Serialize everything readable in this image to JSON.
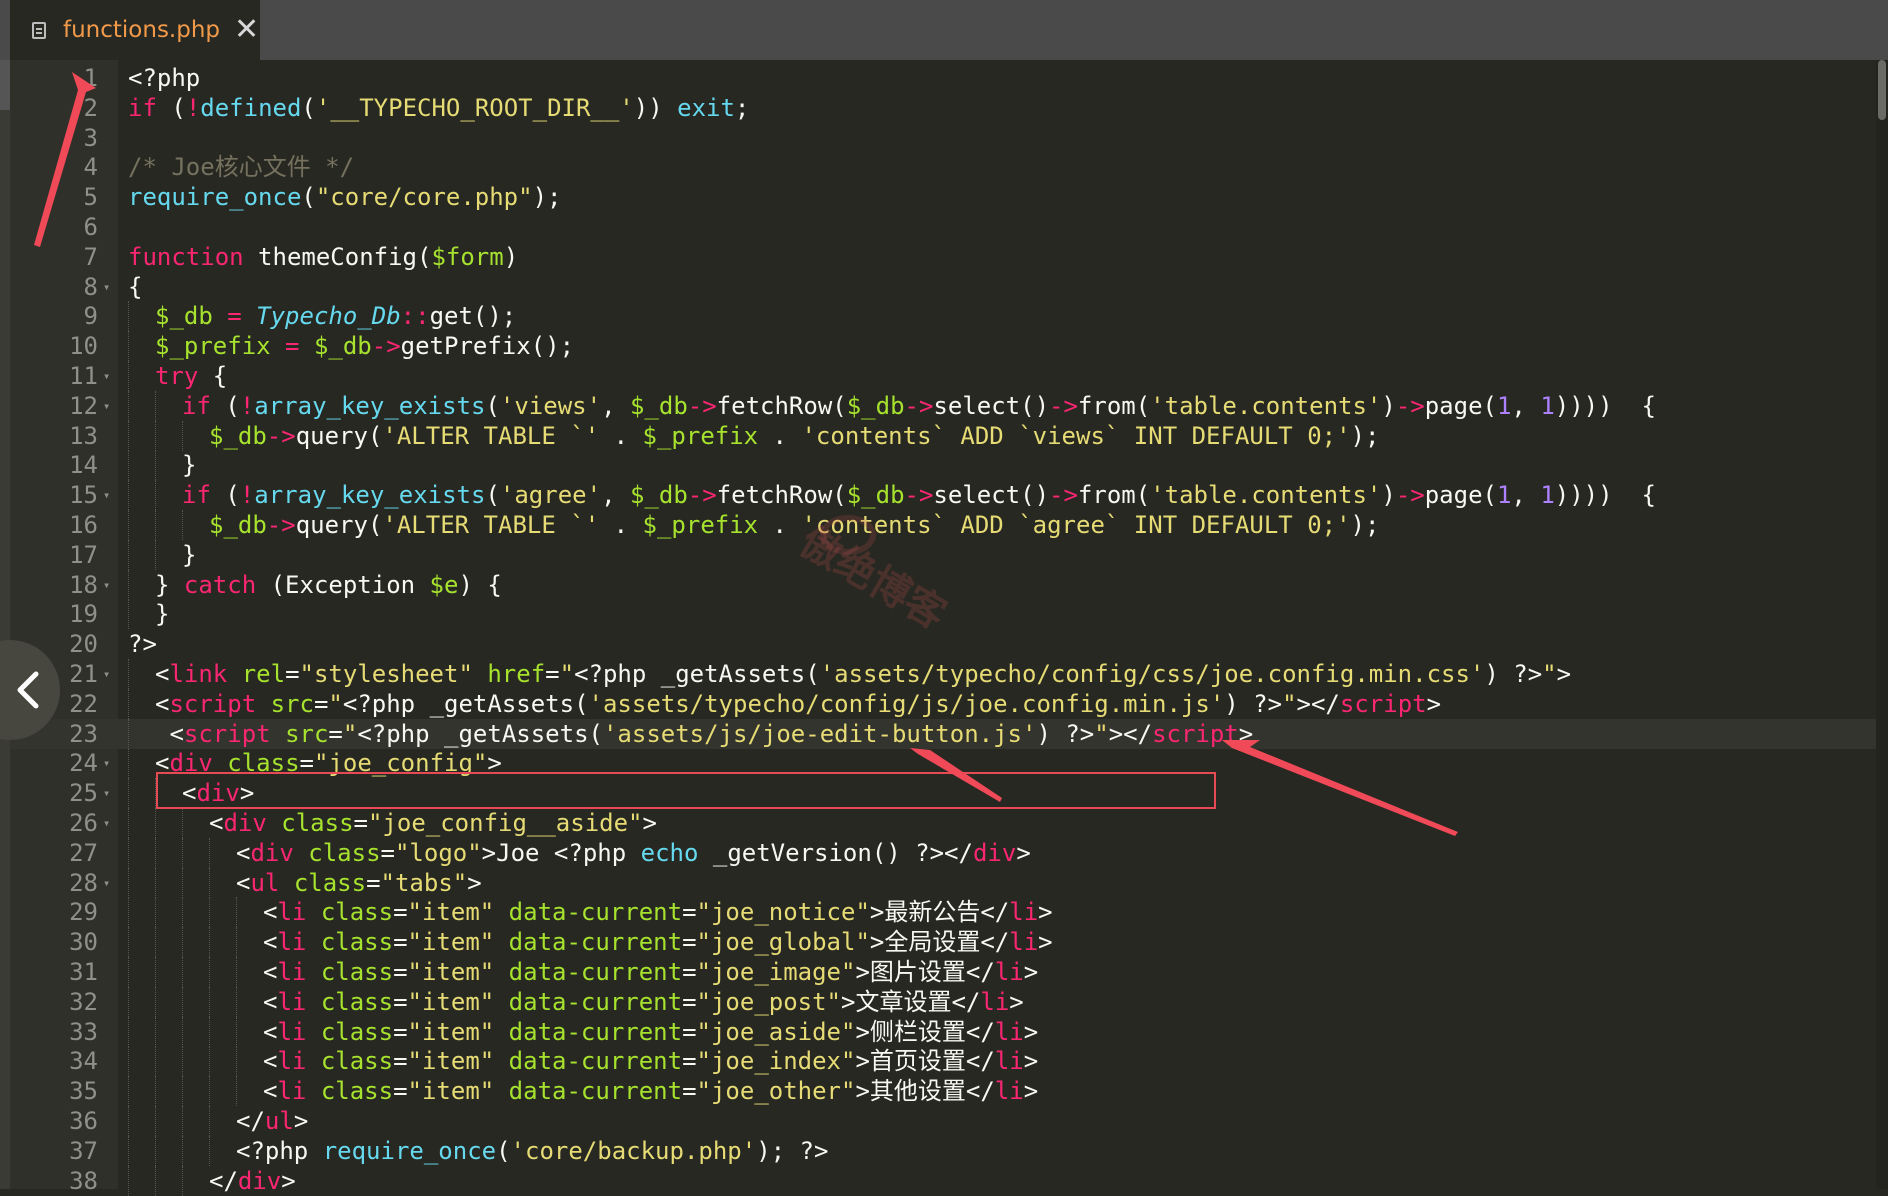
{
  "tab": {
    "title": "functions.php",
    "icon": "file-icon",
    "close_label": "✕"
  },
  "colors": {
    "keyword": "#f92672",
    "string": "#e6db74",
    "comment": "#75715e",
    "function": "#66d9ef",
    "variable": "#a6e22e",
    "number": "#ae81ff",
    "annotation": "#e74a54",
    "background": "#272822"
  },
  "watermark": "傲绝博客",
  "lines": [
    {
      "n": "1",
      "f": false,
      "indent": 0,
      "toks": [
        [
          "w",
          "<?php"
        ]
      ]
    },
    {
      "n": "2",
      "f": false,
      "indent": 0,
      "toks": [
        [
          "k",
          "if"
        ],
        [
          "w",
          " ("
        ],
        [
          "k",
          "!"
        ],
        [
          "f",
          "defined"
        ],
        [
          "w",
          "("
        ],
        [
          "s",
          "'__TYPECHO_ROOT_DIR__'"
        ],
        [
          "w",
          ")) "
        ],
        [
          "f",
          "exit"
        ],
        [
          "w",
          ";"
        ]
      ]
    },
    {
      "n": "3",
      "f": false,
      "indent": 0,
      "toks": []
    },
    {
      "n": "4",
      "f": false,
      "indent": 0,
      "toks": [
        [
          "c",
          "/* Joe核心文件 */"
        ]
      ]
    },
    {
      "n": "5",
      "f": false,
      "indent": 0,
      "toks": [
        [
          "f",
          "require_once"
        ],
        [
          "w",
          "("
        ],
        [
          "s",
          "\"core/core.php\""
        ],
        [
          "w",
          ");"
        ]
      ]
    },
    {
      "n": "6",
      "f": false,
      "indent": 0,
      "toks": []
    },
    {
      "n": "7",
      "f": false,
      "indent": 0,
      "toks": [
        [
          "k",
          "function"
        ],
        [
          "w",
          " themeConfig("
        ],
        [
          "v",
          "$form"
        ],
        [
          "w",
          ")"
        ]
      ]
    },
    {
      "n": "8",
      "f": true,
      "indent": 0,
      "toks": [
        [
          "w",
          "{"
        ]
      ]
    },
    {
      "n": "9",
      "f": false,
      "indent": 1,
      "toks": [
        [
          "v",
          "$_db"
        ],
        [
          "w",
          " "
        ],
        [
          "k",
          "="
        ],
        [
          "w",
          " "
        ],
        [
          "i",
          "Typecho_Db"
        ],
        [
          "k",
          "::"
        ],
        [
          "w",
          "get();"
        ]
      ]
    },
    {
      "n": "10",
      "f": false,
      "indent": 1,
      "toks": [
        [
          "v",
          "$_prefix"
        ],
        [
          "w",
          " "
        ],
        [
          "k",
          "="
        ],
        [
          "w",
          " "
        ],
        [
          "v",
          "$_db"
        ],
        [
          "k",
          "->"
        ],
        [
          "w",
          "getPrefix();"
        ]
      ]
    },
    {
      "n": "11",
      "f": true,
      "indent": 1,
      "toks": [
        [
          "k",
          "try"
        ],
        [
          "w",
          " {"
        ]
      ]
    },
    {
      "n": "12",
      "f": true,
      "indent": 2,
      "toks": [
        [
          "k",
          "if"
        ],
        [
          "w",
          " ("
        ],
        [
          "k",
          "!"
        ],
        [
          "f",
          "array_key_exists"
        ],
        [
          "w",
          "("
        ],
        [
          "s",
          "'views'"
        ],
        [
          "w",
          ", "
        ],
        [
          "v",
          "$_db"
        ],
        [
          "k",
          "->"
        ],
        [
          "w",
          "fetchRow("
        ],
        [
          "v",
          "$_db"
        ],
        [
          "k",
          "->"
        ],
        [
          "w",
          "select()"
        ],
        [
          "k",
          "->"
        ],
        [
          "w",
          "from("
        ],
        [
          "s",
          "'table.contents'"
        ],
        [
          "w",
          ")"
        ],
        [
          "k",
          "->"
        ],
        [
          "w",
          "page("
        ],
        [
          "n",
          "1"
        ],
        [
          "w",
          ", "
        ],
        [
          "n",
          "1"
        ],
        [
          "w",
          "))))  {"
        ]
      ]
    },
    {
      "n": "13",
      "f": false,
      "indent": 3,
      "toks": [
        [
          "v",
          "$_db"
        ],
        [
          "k",
          "->"
        ],
        [
          "w",
          "query("
        ],
        [
          "s",
          "'ALTER TABLE `'"
        ],
        [
          "w",
          " . "
        ],
        [
          "v",
          "$_prefix"
        ],
        [
          "w",
          " . "
        ],
        [
          "s",
          "'contents` ADD `views` INT DEFAULT 0;'"
        ],
        [
          "w",
          ");"
        ]
      ]
    },
    {
      "n": "14",
      "f": false,
      "indent": 2,
      "toks": [
        [
          "w",
          "}"
        ]
      ]
    },
    {
      "n": "15",
      "f": true,
      "indent": 2,
      "toks": [
        [
          "k",
          "if"
        ],
        [
          "w",
          " ("
        ],
        [
          "k",
          "!"
        ],
        [
          "f",
          "array_key_exists"
        ],
        [
          "w",
          "("
        ],
        [
          "s",
          "'agree'"
        ],
        [
          "w",
          ", "
        ],
        [
          "v",
          "$_db"
        ],
        [
          "k",
          "->"
        ],
        [
          "w",
          "fetchRow("
        ],
        [
          "v",
          "$_db"
        ],
        [
          "k",
          "->"
        ],
        [
          "w",
          "select()"
        ],
        [
          "k",
          "->"
        ],
        [
          "w",
          "from("
        ],
        [
          "s",
          "'table.contents'"
        ],
        [
          "w",
          ")"
        ],
        [
          "k",
          "->"
        ],
        [
          "w",
          "page("
        ],
        [
          "n",
          "1"
        ],
        [
          "w",
          ", "
        ],
        [
          "n",
          "1"
        ],
        [
          "w",
          "))))  {"
        ]
      ]
    },
    {
      "n": "16",
      "f": false,
      "indent": 3,
      "toks": [
        [
          "v",
          "$_db"
        ],
        [
          "k",
          "->"
        ],
        [
          "w",
          "query("
        ],
        [
          "s",
          "'ALTER TABLE `'"
        ],
        [
          "w",
          " . "
        ],
        [
          "v",
          "$_prefix"
        ],
        [
          "w",
          " . "
        ],
        [
          "s",
          "'contents` ADD `agree` INT DEFAULT 0;'"
        ],
        [
          "w",
          ");"
        ]
      ]
    },
    {
      "n": "17",
      "f": false,
      "indent": 2,
      "toks": [
        [
          "w",
          "}"
        ]
      ]
    },
    {
      "n": "18",
      "f": true,
      "indent": 1,
      "toks": [
        [
          "w",
          "} "
        ],
        [
          "k",
          "catch"
        ],
        [
          "w",
          " (Exception "
        ],
        [
          "v",
          "$e"
        ],
        [
          "w",
          ") {"
        ]
      ]
    },
    {
      "n": "19",
      "f": false,
      "indent": 1,
      "toks": [
        [
          "w",
          "}"
        ]
      ]
    },
    {
      "n": "20",
      "f": false,
      "indent": 0,
      "toks": [
        [
          "w",
          "?>"
        ]
      ]
    },
    {
      "n": "21",
      "f": true,
      "indent": 1,
      "toks": [
        [
          "w",
          "<"
        ],
        [
          "t",
          "link"
        ],
        [
          "w",
          " "
        ],
        [
          "a",
          "rel"
        ],
        [
          "w",
          "="
        ],
        [
          "s",
          "\"stylesheet\""
        ],
        [
          "w",
          " "
        ],
        [
          "a",
          "href"
        ],
        [
          "w",
          "="
        ],
        [
          "s",
          "\""
        ],
        [
          "w",
          "<?php _getAssets("
        ],
        [
          "s",
          "'assets/typecho/config/css/joe.config.min.css'"
        ],
        [
          "w",
          ") ?>"
        ],
        [
          "s",
          "\""
        ],
        [
          "w",
          ">"
        ]
      ]
    },
    {
      "n": "22",
      "f": false,
      "indent": 1,
      "toks": [
        [
          "w",
          "<"
        ],
        [
          "t",
          "script"
        ],
        [
          "w",
          " "
        ],
        [
          "a",
          "src"
        ],
        [
          "w",
          "="
        ],
        [
          "s",
          "\""
        ],
        [
          "w",
          "<?php _getAssets("
        ],
        [
          "s",
          "'assets/typecho/config/js/joe.config.min.js'"
        ],
        [
          "w",
          ") ?>"
        ],
        [
          "s",
          "\""
        ],
        [
          "w",
          "></"
        ],
        [
          "t",
          "script"
        ],
        [
          "w",
          ">"
        ]
      ]
    },
    {
      "n": "23",
      "f": false,
      "indent": 1,
      "active": true,
      "toks": [
        [
          "w",
          " <"
        ],
        [
          "t",
          "script"
        ],
        [
          "w",
          " "
        ],
        [
          "a",
          "src"
        ],
        [
          "w",
          "="
        ],
        [
          "s",
          "\""
        ],
        [
          "w",
          "<?php _getAssets("
        ],
        [
          "s",
          "'assets/js/joe-edit-button.js'"
        ],
        [
          "w",
          ") ?>"
        ],
        [
          "s",
          "\""
        ],
        [
          "w",
          "></"
        ],
        [
          "t",
          "script"
        ],
        [
          "w",
          ">"
        ]
      ]
    },
    {
      "n": "24",
      "f": true,
      "indent": 1,
      "toks": [
        [
          "w",
          "<"
        ],
        [
          "t",
          "div"
        ],
        [
          "w",
          " "
        ],
        [
          "a",
          "class"
        ],
        [
          "w",
          "="
        ],
        [
          "s",
          "\"joe_config\""
        ],
        [
          "w",
          ">"
        ]
      ]
    },
    {
      "n": "25",
      "f": true,
      "indent": 2,
      "toks": [
        [
          "w",
          "<"
        ],
        [
          "t",
          "div"
        ],
        [
          "w",
          ">"
        ]
      ]
    },
    {
      "n": "26",
      "f": true,
      "indent": 3,
      "toks": [
        [
          "w",
          "<"
        ],
        [
          "t",
          "div"
        ],
        [
          "w",
          " "
        ],
        [
          "a",
          "class"
        ],
        [
          "w",
          "="
        ],
        [
          "s",
          "\"joe_config__aside\""
        ],
        [
          "w",
          ">"
        ]
      ]
    },
    {
      "n": "27",
      "f": false,
      "indent": 4,
      "toks": [
        [
          "w",
          "<"
        ],
        [
          "t",
          "div"
        ],
        [
          "w",
          " "
        ],
        [
          "a",
          "class"
        ],
        [
          "w",
          "="
        ],
        [
          "s",
          "\"logo\""
        ],
        [
          "w",
          ">Joe <?php "
        ],
        [
          "f",
          "echo"
        ],
        [
          "w",
          " _getVersion() ?></"
        ],
        [
          "t",
          "div"
        ],
        [
          "w",
          ">"
        ]
      ]
    },
    {
      "n": "28",
      "f": true,
      "indent": 4,
      "toks": [
        [
          "w",
          "<"
        ],
        [
          "t",
          "ul"
        ],
        [
          "w",
          " "
        ],
        [
          "a",
          "class"
        ],
        [
          "w",
          "="
        ],
        [
          "s",
          "\"tabs\""
        ],
        [
          "w",
          ">"
        ]
      ]
    },
    {
      "n": "29",
      "f": false,
      "indent": 5,
      "toks": [
        [
          "w",
          "<"
        ],
        [
          "t",
          "li"
        ],
        [
          "w",
          " "
        ],
        [
          "a",
          "class"
        ],
        [
          "w",
          "="
        ],
        [
          "s",
          "\"item\""
        ],
        [
          "w",
          " "
        ],
        [
          "a",
          "data-current"
        ],
        [
          "w",
          "="
        ],
        [
          "s",
          "\"joe_notice\""
        ],
        [
          "w",
          ">最新公告</"
        ],
        [
          "t",
          "li"
        ],
        [
          "w",
          ">"
        ]
      ]
    },
    {
      "n": "30",
      "f": false,
      "indent": 5,
      "toks": [
        [
          "w",
          "<"
        ],
        [
          "t",
          "li"
        ],
        [
          "w",
          " "
        ],
        [
          "a",
          "class"
        ],
        [
          "w",
          "="
        ],
        [
          "s",
          "\"item\""
        ],
        [
          "w",
          " "
        ],
        [
          "a",
          "data-current"
        ],
        [
          "w",
          "="
        ],
        [
          "s",
          "\"joe_global\""
        ],
        [
          "w",
          ">全局设置</"
        ],
        [
          "t",
          "li"
        ],
        [
          "w",
          ">"
        ]
      ]
    },
    {
      "n": "31",
      "f": false,
      "indent": 5,
      "toks": [
        [
          "w",
          "<"
        ],
        [
          "t",
          "li"
        ],
        [
          "w",
          " "
        ],
        [
          "a",
          "class"
        ],
        [
          "w",
          "="
        ],
        [
          "s",
          "\"item\""
        ],
        [
          "w",
          " "
        ],
        [
          "a",
          "data-current"
        ],
        [
          "w",
          "="
        ],
        [
          "s",
          "\"joe_image\""
        ],
        [
          "w",
          ">图片设置</"
        ],
        [
          "t",
          "li"
        ],
        [
          "w",
          ">"
        ]
      ]
    },
    {
      "n": "32",
      "f": false,
      "indent": 5,
      "toks": [
        [
          "w",
          "<"
        ],
        [
          "t",
          "li"
        ],
        [
          "w",
          " "
        ],
        [
          "a",
          "class"
        ],
        [
          "w",
          "="
        ],
        [
          "s",
          "\"item\""
        ],
        [
          "w",
          " "
        ],
        [
          "a",
          "data-current"
        ],
        [
          "w",
          "="
        ],
        [
          "s",
          "\"joe_post\""
        ],
        [
          "w",
          ">文章设置</"
        ],
        [
          "t",
          "li"
        ],
        [
          "w",
          ">"
        ]
      ]
    },
    {
      "n": "33",
      "f": false,
      "indent": 5,
      "toks": [
        [
          "w",
          "<"
        ],
        [
          "t",
          "li"
        ],
        [
          "w",
          " "
        ],
        [
          "a",
          "class"
        ],
        [
          "w",
          "="
        ],
        [
          "s",
          "\"item\""
        ],
        [
          "w",
          " "
        ],
        [
          "a",
          "data-current"
        ],
        [
          "w",
          "="
        ],
        [
          "s",
          "\"joe_aside\""
        ],
        [
          "w",
          ">侧栏设置</"
        ],
        [
          "t",
          "li"
        ],
        [
          "w",
          ">"
        ]
      ]
    },
    {
      "n": "34",
      "f": false,
      "indent": 5,
      "toks": [
        [
          "w",
          "<"
        ],
        [
          "t",
          "li"
        ],
        [
          "w",
          " "
        ],
        [
          "a",
          "class"
        ],
        [
          "w",
          "="
        ],
        [
          "s",
          "\"item\""
        ],
        [
          "w",
          " "
        ],
        [
          "a",
          "data-current"
        ],
        [
          "w",
          "="
        ],
        [
          "s",
          "\"joe_index\""
        ],
        [
          "w",
          ">首页设置</"
        ],
        [
          "t",
          "li"
        ],
        [
          "w",
          ">"
        ]
      ]
    },
    {
      "n": "35",
      "f": false,
      "indent": 5,
      "toks": [
        [
          "w",
          "<"
        ],
        [
          "t",
          "li"
        ],
        [
          "w",
          " "
        ],
        [
          "a",
          "class"
        ],
        [
          "w",
          "="
        ],
        [
          "s",
          "\"item\""
        ],
        [
          "w",
          " "
        ],
        [
          "a",
          "data-current"
        ],
        [
          "w",
          "="
        ],
        [
          "s",
          "\"joe_other\""
        ],
        [
          "w",
          ">其他设置</"
        ],
        [
          "t",
          "li"
        ],
        [
          "w",
          ">"
        ]
      ]
    },
    {
      "n": "36",
      "f": false,
      "indent": 4,
      "toks": [
        [
          "w",
          "</"
        ],
        [
          "t",
          "ul"
        ],
        [
          "w",
          ">"
        ]
      ]
    },
    {
      "n": "37",
      "f": false,
      "indent": 4,
      "toks": [
        [
          "w",
          "<?php "
        ],
        [
          "f",
          "require_once"
        ],
        [
          "w",
          "("
        ],
        [
          "s",
          "'core/backup.php'"
        ],
        [
          "w",
          "); ?>"
        ]
      ]
    },
    {
      "n": "38",
      "f": false,
      "indent": 3,
      "toks": [
        [
          "w",
          "</"
        ],
        [
          "t",
          "div"
        ],
        [
          "w",
          ">"
        ]
      ]
    }
  ]
}
